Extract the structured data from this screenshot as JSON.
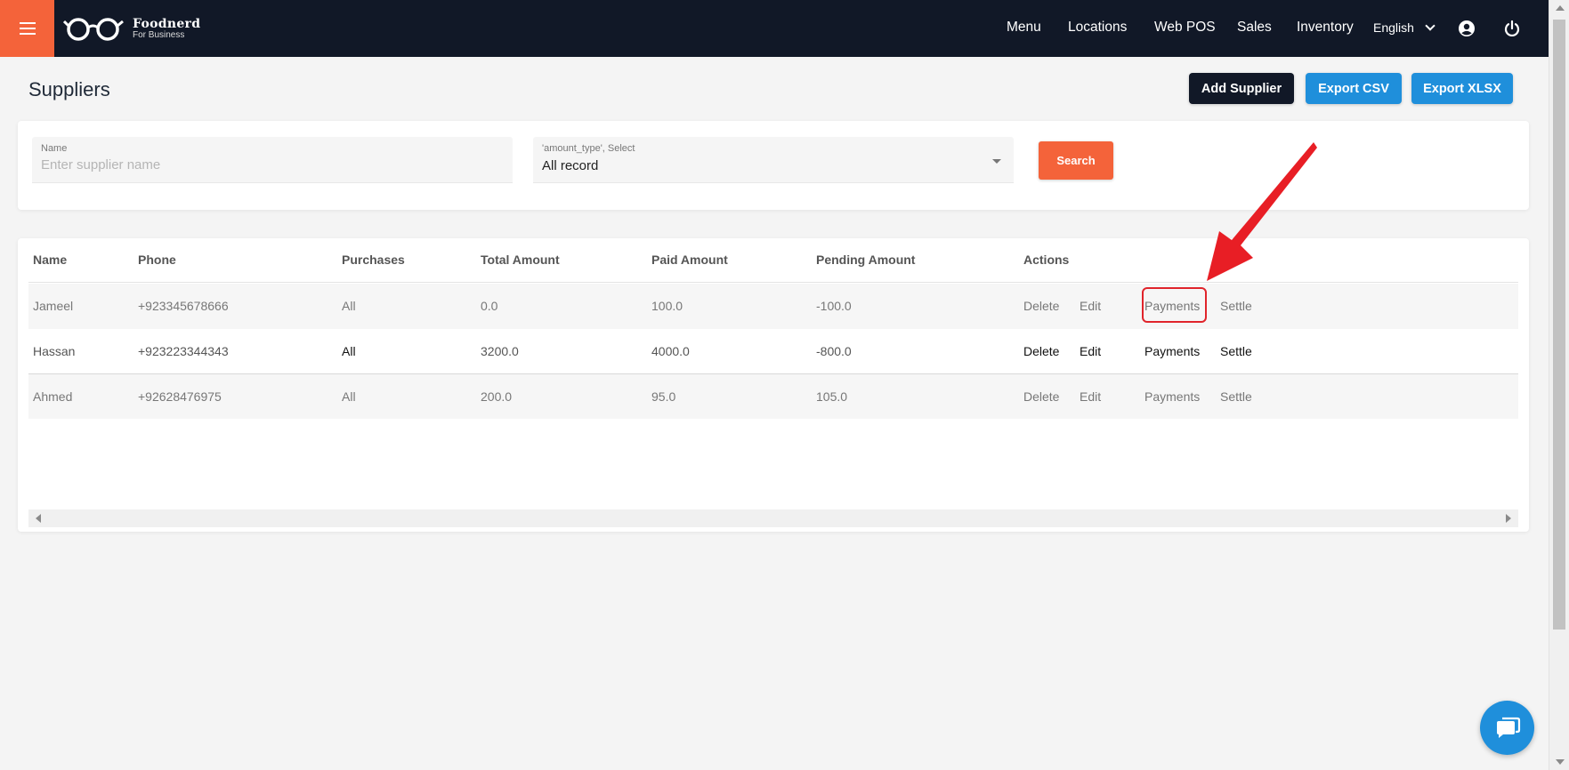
{
  "header": {
    "brand": "Foodnerd",
    "brand_sub": "For Business",
    "nav": [
      "Menu",
      "Locations",
      "Web POS",
      "Sales",
      "Inventory"
    ],
    "language": "English",
    "colors": {
      "bar": "#111827",
      "accent": "#f4633a"
    }
  },
  "page": {
    "title": "Suppliers",
    "buttons": {
      "add": "Add Supplier",
      "csv": "Export CSV",
      "xlsx": "Export XLSX"
    }
  },
  "filters": {
    "name_label": "Name",
    "name_placeholder": "Enter supplier name",
    "type_label": "'amount_type', Select",
    "type_value": "All record",
    "search": "Search"
  },
  "table": {
    "headers": [
      "Name",
      "Phone",
      "Purchases",
      "Total Amount",
      "Paid Amount",
      "Pending Amount",
      "Actions"
    ],
    "rows": [
      {
        "name": "Jameel",
        "phone": "+923345678666",
        "purchases": "All",
        "total": "0.0",
        "paid": "100.0",
        "pending": "-100.0",
        "actions": [
          "Delete",
          "Edit",
          "Payments",
          "Settle"
        ]
      },
      {
        "name": "Hassan",
        "phone": "+923223344343",
        "purchases": "All",
        "total": "3200.0",
        "paid": "4000.0",
        "pending": "-800.0",
        "actions": [
          "Delete",
          "Edit",
          "Payments",
          "Settle"
        ]
      },
      {
        "name": "Ahmed",
        "phone": "+92628476975",
        "purchases": "All",
        "total": "200.0",
        "paid": "95.0",
        "pending": "105.0",
        "actions": [
          "Delete",
          "Edit",
          "Payments",
          "Settle"
        ]
      }
    ]
  },
  "annotation": {
    "target": "Payments",
    "color": "#e0242b"
  }
}
